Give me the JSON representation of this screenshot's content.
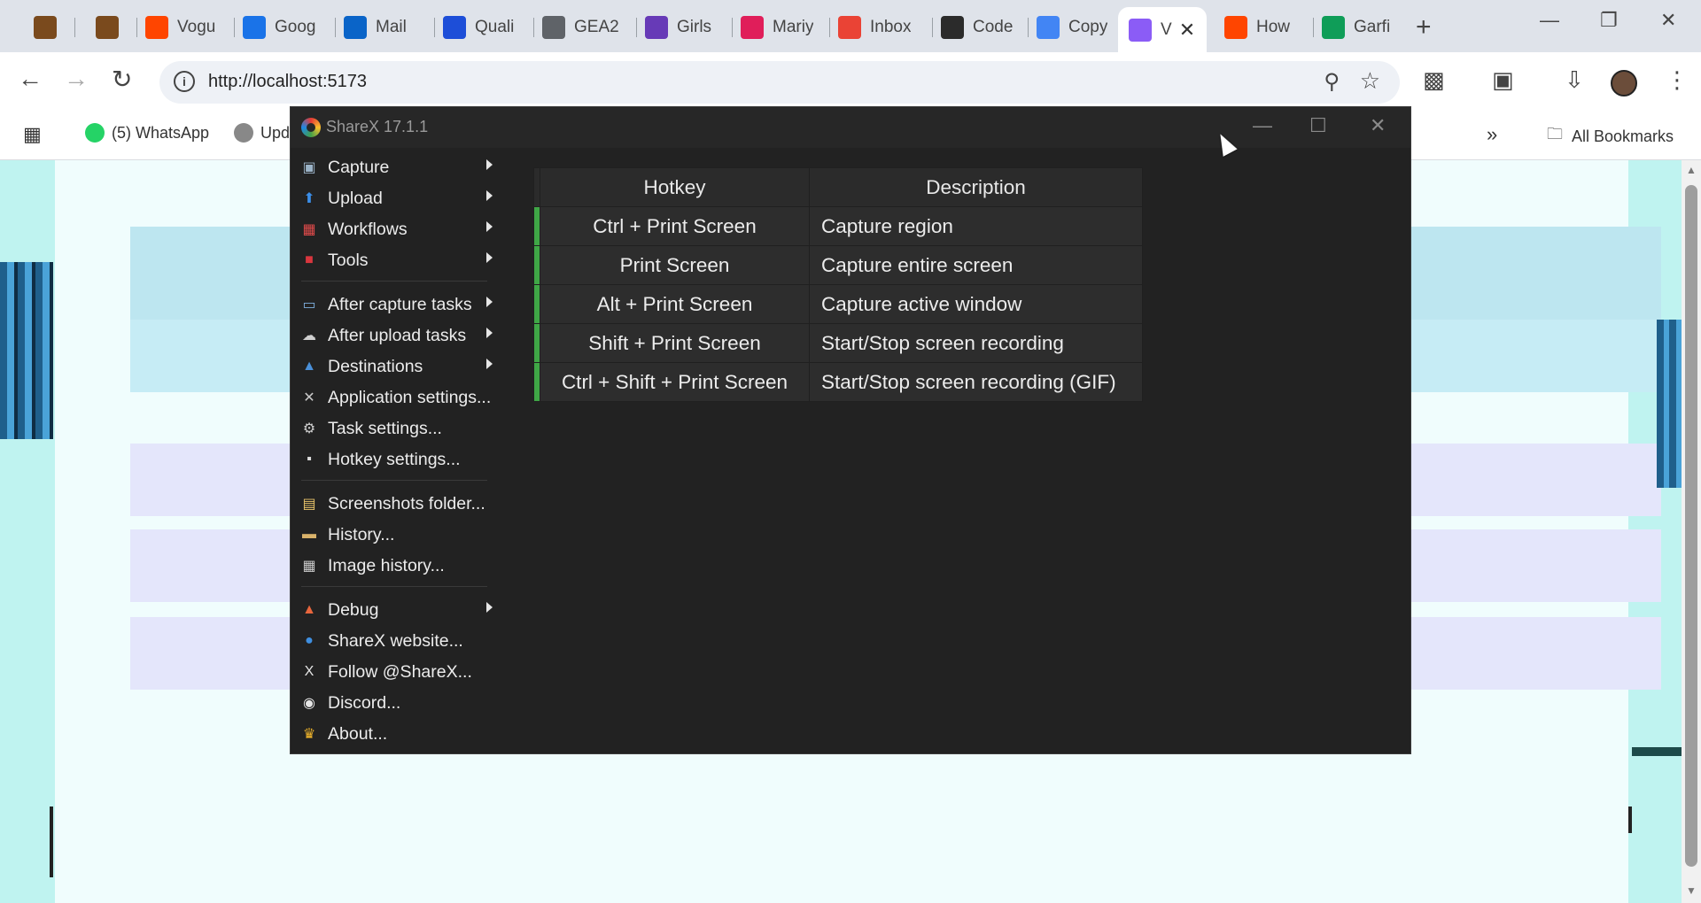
{
  "browser": {
    "tabs": [
      {
        "label": "",
        "icon": "shopping-bag-icon",
        "color": "#7a4a1d"
      },
      {
        "label": "",
        "icon": "shopping-bag-icon",
        "color": "#7a4a1d"
      },
      {
        "label": "Vogu",
        "icon": "reddit-icon",
        "color": "#ff4500"
      },
      {
        "label": "Goog",
        "icon": "google-sites-icon",
        "color": "#1a73e8"
      },
      {
        "label": "Mail",
        "icon": "outlook-icon",
        "color": "#0a64c8"
      },
      {
        "label": "Quali",
        "icon": "xm-icon",
        "color": "#1d4ed8"
      },
      {
        "label": "GEA2",
        "icon": "globe-icon",
        "color": "#5f6368"
      },
      {
        "label": "Girls",
        "icon": "forms-icon",
        "color": "#673ab7"
      },
      {
        "label": "Mariy",
        "icon": "slack-icon",
        "color": "#e01e5a"
      },
      {
        "label": "Inbox",
        "icon": "gmail-icon",
        "color": "#ea4335"
      },
      {
        "label": "Code",
        "icon": "codepath-icon",
        "color": "#2b2b2b"
      },
      {
        "label": "Copy",
        "icon": "docs-icon",
        "color": "#4285f4"
      },
      {
        "label": "V",
        "icon": "vite-icon",
        "color": "#8b5cf6"
      },
      {
        "label": "How",
        "icon": "reddit-icon",
        "color": "#ff4500"
      },
      {
        "label": "Garfi",
        "icon": "sheets-icon",
        "color": "#0f9d58"
      }
    ],
    "active_tab_close": "✕",
    "new_tab": "+",
    "url": "http://localhost:5173",
    "bookmarks": [
      {
        "label": "(5) WhatsApp",
        "color": "#25d366"
      },
      {
        "label": "Upd",
        "color": "#888888"
      }
    ],
    "overflow": "»",
    "all_bookmarks": "All Bookmarks"
  },
  "sharex": {
    "title": "ShareX 17.1.1",
    "menu": [
      {
        "label": "Capture",
        "icon": "capture-icon",
        "glyph": "▣",
        "color": "#9bb3c7",
        "submenu": true
      },
      {
        "label": "Upload",
        "icon": "upload-arrow-icon",
        "glyph": "⬆",
        "color": "#3b8ee8",
        "submenu": true
      },
      {
        "label": "Workflows",
        "icon": "workflows-grid-icon",
        "glyph": "▦",
        "color": "#e24b4b",
        "submenu": true
      },
      {
        "label": "Tools",
        "icon": "toolbox-icon",
        "glyph": "■",
        "color": "#d9363e",
        "submenu": true
      },
      {
        "label": "After capture tasks",
        "icon": "after-capture-icon",
        "glyph": "▭",
        "color": "#7fb0e0",
        "submenu": true
      },
      {
        "label": "After upload tasks",
        "icon": "cloud-upload-icon",
        "glyph": "☁",
        "color": "#d0d0d0",
        "submenu": true
      },
      {
        "label": "Destinations",
        "icon": "destinations-icon",
        "glyph": "▲",
        "color": "#4a90d9",
        "submenu": true
      },
      {
        "label": "Application settings...",
        "icon": "wrench-icon",
        "glyph": "✕",
        "color": "#c9c9c9",
        "submenu": false
      },
      {
        "label": "Task settings...",
        "icon": "gear-icon",
        "glyph": "⚙",
        "color": "#cfcfcf",
        "submenu": false
      },
      {
        "label": "Hotkey settings...",
        "icon": "keyboard-icon",
        "glyph": "▪",
        "color": "#dddddd",
        "submenu": false
      },
      {
        "label": "Screenshots folder...",
        "icon": "folder-icon",
        "glyph": "▤",
        "color": "#e9c46a",
        "submenu": false
      },
      {
        "label": "History...",
        "icon": "history-icon",
        "glyph": "▬",
        "color": "#d9b26a",
        "submenu": false
      },
      {
        "label": "Image history...",
        "icon": "image-history-icon",
        "glyph": "▦",
        "color": "#c9c9c9",
        "submenu": false
      },
      {
        "label": "Debug",
        "icon": "debug-cone-icon",
        "glyph": "▲",
        "color": "#e8663d",
        "submenu": true
      },
      {
        "label": "ShareX website...",
        "icon": "globe-icon",
        "glyph": "●",
        "color": "#3f8fe0",
        "submenu": false
      },
      {
        "label": "Follow @ShareX...",
        "icon": "x-logo-icon",
        "glyph": "X",
        "color": "#e6e6e6",
        "submenu": false
      },
      {
        "label": "Discord...",
        "icon": "discord-icon",
        "glyph": "◉",
        "color": "#e6e6e6",
        "submenu": false
      },
      {
        "label": "About...",
        "icon": "crown-icon",
        "glyph": "♛",
        "color": "#f2b62b",
        "submenu": false
      }
    ],
    "table": {
      "headers": [
        "Hotkey",
        "Description"
      ],
      "rows": [
        {
          "hotkey": "Ctrl + Print Screen",
          "description": "Capture region"
        },
        {
          "hotkey": "Print Screen",
          "description": "Capture entire screen"
        },
        {
          "hotkey": "Alt + Print Screen",
          "description": "Capture active window"
        },
        {
          "hotkey": "Shift + Print Screen",
          "description": "Start/Stop screen recording"
        },
        {
          "hotkey": "Ctrl + Shift + Print Screen",
          "description": "Start/Stop screen recording (GIF)"
        }
      ],
      "enabled_color": "#3fa646"
    }
  }
}
